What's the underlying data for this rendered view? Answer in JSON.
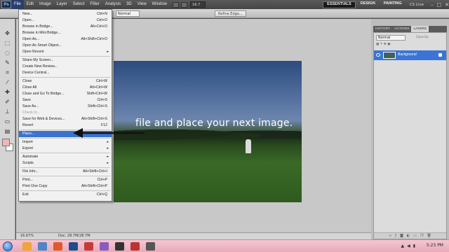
{
  "app": {
    "logo": "Ps",
    "menus": [
      "File",
      "Edit",
      "Image",
      "Layer",
      "Select",
      "Filter",
      "Analysis",
      "3D",
      "View",
      "Window"
    ],
    "active_menu_index": 0,
    "zoom": "16.7",
    "workspaces": [
      "ESSENTIALS",
      "DESIGN",
      "PAINTING"
    ],
    "active_workspace_index": 0,
    "cs_live": "CS Live"
  },
  "options_bar": {
    "style_value": "Normal",
    "refine_edge": "Refine Edge..."
  },
  "document": {
    "overlay_text": "file and place your next image."
  },
  "file_menu": {
    "items": [
      {
        "label": "New...",
        "shortcut": "Ctrl+N"
      },
      {
        "label": "Open...",
        "shortcut": "Ctrl+O"
      },
      {
        "label": "Browse in Bridge...",
        "shortcut": "Alt+Ctrl+O"
      },
      {
        "label": "Browse in Mini Bridge...",
        "shortcut": ""
      },
      {
        "label": "Open As...",
        "shortcut": "Alt+Shift+Ctrl+O"
      },
      {
        "label": "Open As Smart Object...",
        "shortcut": ""
      },
      {
        "label": "Open Recent",
        "shortcut": "",
        "submenu": true
      },
      {
        "separator": true
      },
      {
        "label": "Share My Screen...",
        "shortcut": ""
      },
      {
        "label": "Create New Review...",
        "shortcut": ""
      },
      {
        "label": "Device Central...",
        "shortcut": ""
      },
      {
        "separator": true
      },
      {
        "label": "Close",
        "shortcut": "Ctrl+W"
      },
      {
        "label": "Close All",
        "shortcut": "Alt+Ctrl+W"
      },
      {
        "label": "Close and Go To Bridge...",
        "shortcut": "Shift+Ctrl+W"
      },
      {
        "label": "Save",
        "shortcut": "Ctrl+S"
      },
      {
        "label": "Save As...",
        "shortcut": "Shift+Ctrl+S"
      },
      {
        "label": "Check In...",
        "shortcut": "",
        "disabled": true
      },
      {
        "label": "Save for Web & Devices...",
        "shortcut": "Alt+Shift+Ctrl+S"
      },
      {
        "label": "Revert",
        "shortcut": "F12"
      },
      {
        "separator": true
      },
      {
        "label": "Place...",
        "shortcut": "",
        "highlight": true
      },
      {
        "separator": true
      },
      {
        "label": "Import",
        "shortcut": "",
        "submenu": true
      },
      {
        "label": "Export",
        "shortcut": "",
        "submenu": true
      },
      {
        "separator": true
      },
      {
        "label": "Automate",
        "shortcut": "",
        "submenu": true
      },
      {
        "label": "Scripts",
        "shortcut": "",
        "submenu": true
      },
      {
        "separator": true
      },
      {
        "label": "File Info...",
        "shortcut": "Alt+Shift+Ctrl+I"
      },
      {
        "separator": true
      },
      {
        "label": "Print...",
        "shortcut": "Ctrl+P"
      },
      {
        "label": "Print One Copy",
        "shortcut": "Alt+Shift+Ctrl+P"
      },
      {
        "separator": true
      },
      {
        "label": "Exit",
        "shortcut": "Ctrl+Q"
      }
    ]
  },
  "status_bar": {
    "zoom": "16.67%",
    "doc_info": "Doc: 28.7M/28.7M"
  },
  "panels": {
    "tabs": [
      "HISTORY",
      "ACTIONS",
      "LAYERS"
    ],
    "active_tab_index": 2,
    "blend_mode": "Normal",
    "opacity_label": "Opacity:",
    "layer_name": "Background"
  },
  "taskbar": {
    "clock": "5:23 PM"
  },
  "colors": {
    "menu_highlight": "#3974cf",
    "layer_selected": "#3b74d6",
    "taskbar": "#efb9c8"
  }
}
